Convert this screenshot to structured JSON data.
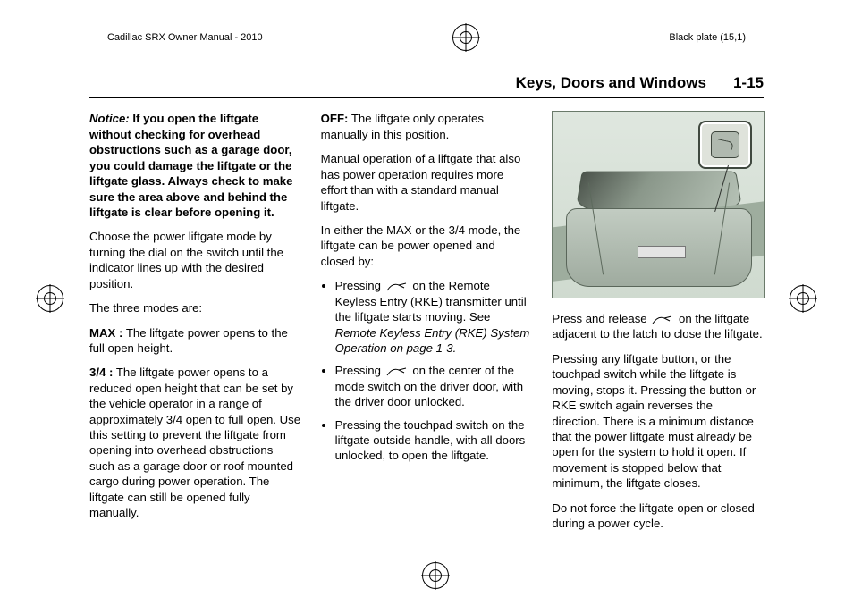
{
  "meta": {
    "left": "Cadillac SRX Owner Manual - 2010",
    "right": "Black plate (15,1)"
  },
  "header": {
    "section": "Keys, Doors and Windows",
    "page": "1-15"
  },
  "col1": {
    "notice_label": "Notice:",
    "notice_body": "If you open the liftgate without checking for overhead obstructions such as a garage door, you could damage the liftgate or the liftgate glass. Always check to make sure the area above and behind the liftgate is clear before opening it.",
    "p1": "Choose the power liftgate mode by turning the dial on the switch until the indicator lines up with the desired position.",
    "p2": "The three modes are:",
    "max_label": "MAX :",
    "max_body": "The liftgate power opens to the full open height.",
    "threeq_label": "3/4 :",
    "threeq_body": "The liftgate power opens to a reduced open height that can be set by the vehicle operator in a range of approximately 3/4 open to full open. Use this setting to prevent the liftgate from opening into overhead obstructions such as a garage door or roof mounted cargo during power operation. The liftgate can still be opened fully manually."
  },
  "col2": {
    "off_label": "OFF:",
    "off_body": "The liftgate only operates manually in this position.",
    "p1": "Manual operation of a liftgate that also has power operation requires more effort than with a standard manual liftgate.",
    "p2": "In either the MAX or the 3/4 mode, the liftgate can be power opened and closed by:",
    "li1a": "Pressing ",
    "li1b": " on the Remote Keyless Entry (RKE) transmitter until the liftgate starts moving. See ",
    "li1_ref": "Remote Keyless Entry (RKE) System Operation on page 1-3.",
    "li2a": "Pressing ",
    "li2b": " on the center of the mode switch on the driver door, with the driver door unlocked.",
    "li3": "Pressing the touchpad switch on the liftgate outside handle, with all doors unlocked, to open the liftgate."
  },
  "col3": {
    "p1a": "Press and release ",
    "p1b": " on the liftgate adjacent to the latch to close the liftgate.",
    "p2": "Pressing any liftgate button, or the touchpad switch while the liftgate is moving, stops it. Pressing the button or RKE switch again reverses the direction. There is a minimum distance that the power liftgate must already be open for the system to hold it open. If movement is stopped below that minimum, the liftgate closes.",
    "p3": "Do not force the liftgate open or closed during a power cycle."
  },
  "icons": {
    "rke": "liftgate-rke-icon",
    "callout": "liftgate-close-button"
  }
}
